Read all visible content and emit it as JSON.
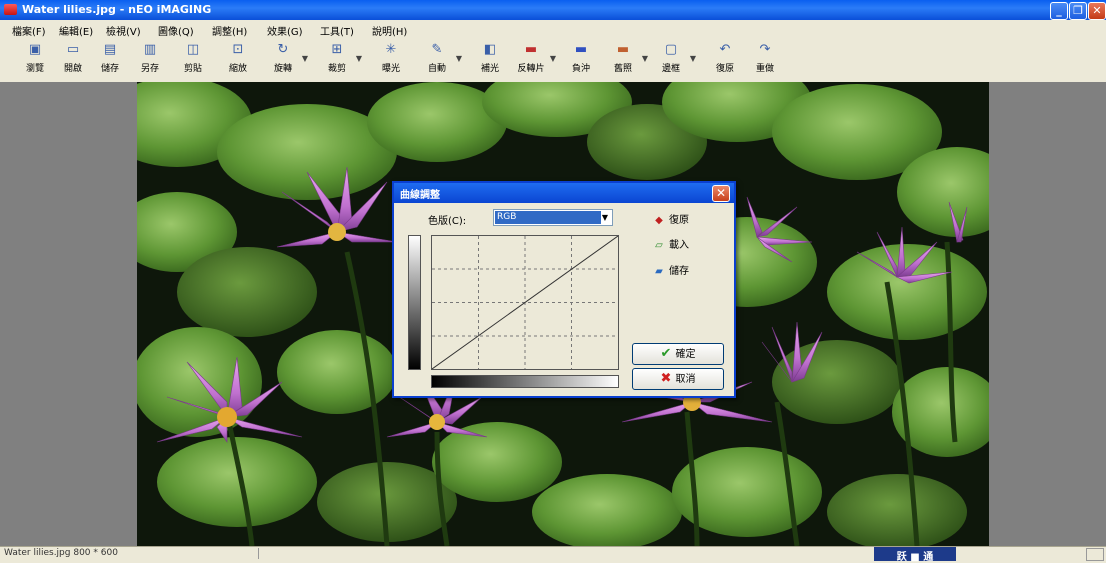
{
  "window": {
    "title": "Water lilies.jpg - nEO iMAGING",
    "minimize_glyph": "_",
    "restore_glyph": "❐",
    "close_glyph": "✕"
  },
  "menu": [
    "檔案(F)",
    "編輯(E)",
    "檢視(V)",
    "圖像(Q)",
    "調整(H)",
    "效果(G)",
    "工具(T)",
    "說明(H)"
  ],
  "toolbar": [
    {
      "label": "瀏覽",
      "icon": "browse-icon",
      "glyph": "▣"
    },
    {
      "label": "開啟",
      "icon": "open-folder-icon",
      "glyph": "▭"
    },
    {
      "label": "儲存",
      "icon": "save-icon",
      "glyph": "▤"
    },
    {
      "label": "另存",
      "icon": "save-as-icon",
      "glyph": "▥"
    },
    {
      "label": "剪貼",
      "icon": "clip-icon",
      "glyph": "◫"
    },
    {
      "label": "縮放",
      "icon": "resize-icon",
      "glyph": "⊡"
    },
    {
      "label": "旋轉",
      "icon": "rotate-icon",
      "glyph": "↻",
      "dropdown": true
    },
    {
      "label": "裁剪",
      "icon": "crop-icon",
      "glyph": "⊞",
      "dropdown": true
    },
    {
      "label": "曝光",
      "icon": "exposure-icon",
      "glyph": "✳"
    },
    {
      "label": "自動",
      "icon": "auto-icon",
      "glyph": "✎",
      "dropdown": true
    },
    {
      "label": "補光",
      "icon": "fill-light-icon",
      "glyph": "◧"
    },
    {
      "label": "反轉片",
      "icon": "reversal-film-icon",
      "glyph": "▬",
      "dropdown": true
    },
    {
      "label": "負沖",
      "icon": "cross-process-icon",
      "glyph": "▬"
    },
    {
      "label": "舊照",
      "icon": "old-photo-icon",
      "glyph": "▬",
      "dropdown": true
    },
    {
      "label": "邊框",
      "icon": "frame-icon",
      "glyph": "▢",
      "dropdown": true
    },
    {
      "label": "復原",
      "icon": "undo-icon",
      "glyph": "↶"
    },
    {
      "label": "重做",
      "icon": "redo-icon",
      "glyph": "↷"
    }
  ],
  "dialog": {
    "title": "曲線調整",
    "close_glyph": "✕",
    "channel_label": "色版(C):",
    "channel_value": "RGB",
    "channel_arrow": "▼",
    "reset_label": "復原",
    "load_label": "載入",
    "save_label": "儲存",
    "ok_label": "確定",
    "cancel_label": "取消"
  },
  "status": {
    "file_info": "Water lilies.jpg  800 * 600",
    "tray_text": "跃 ■ 通"
  },
  "colors": {
    "titlebar": "#0a5ff0",
    "select_highlight": "#316ac5",
    "lily_petal": "#c77ad1",
    "leaf": "#4f8a2f"
  }
}
